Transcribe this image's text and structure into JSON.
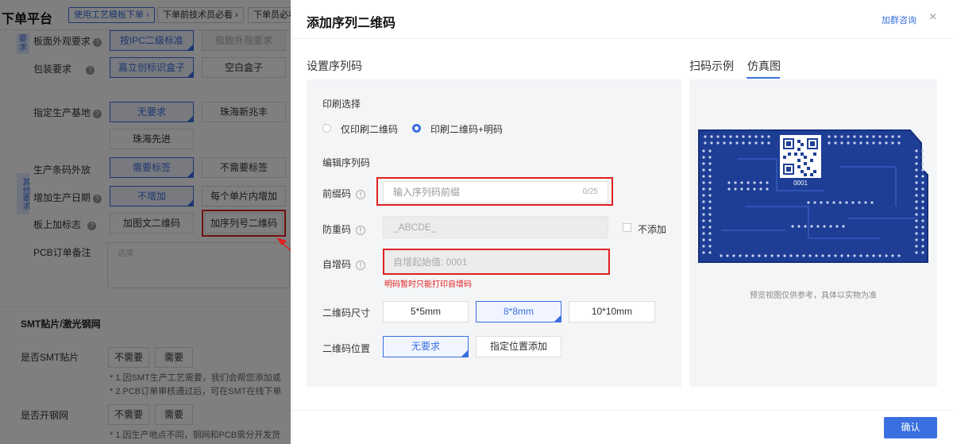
{
  "background": {
    "brand": "下单平台",
    "tabs": [
      "使用工艺模板下单 ›",
      "下单前技术员必看 ›",
      "下单员必看"
    ],
    "side_tags": {
      "req": "要求",
      "other": "其他要求"
    },
    "rows": {
      "board_appearance": {
        "label": "板面外观要求",
        "opt1": "按IPC二级标准",
        "opt2": "极致外观要求"
      },
      "packaging": {
        "label": "包装要求",
        "opt1": "嘉立创标识盒子",
        "opt2": "空白盒子"
      },
      "production_base": {
        "label": "指定生产基地",
        "opt1": "无要求",
        "opt2": "珠海新兆丰",
        "opt3": "珠海先进"
      },
      "barcode": {
        "label": "生产条码外放",
        "opt1": "需要标签",
        "opt2": "不需要标签"
      },
      "date": {
        "label": "增加生产日期",
        "opt1": "不增加",
        "opt2": "每个单片内增加"
      },
      "mark": {
        "label": "板上加标志",
        "opt1": "加图文二维码",
        "opt2": "加序列号二维码"
      },
      "remark": {
        "label": "PCB订单备注",
        "placeholder": "选填"
      }
    },
    "smt_section": "SMT贴片/激光钢网",
    "smt_row": {
      "label": "是否SMT贴片",
      "opt1": "不需要",
      "opt2": "需要"
    },
    "smt_notes": [
      "* 1.因SMT生产工艺需要，我们会帮您添加或",
      "* 2.PCB订单审核通过后，可在SMT在线下单"
    ],
    "stencil_row": {
      "label": "是否开钢网",
      "opt1": "不需要",
      "opt2": "需要"
    },
    "stencil_notes": [
      "* 1.因生产地点不同，钢网和PCB需分开发货"
    ]
  },
  "dialog": {
    "title": "添加序列二维码",
    "join_link": "加群咨询",
    "close_glyph": "×",
    "section_title": "设置序列码",
    "right_tabs": [
      "扫码示例",
      "仿真图"
    ],
    "print_choice_label": "印刷选择",
    "print_options": [
      "仅印刷二维码",
      "印刷二维码+明码"
    ],
    "edit_label": "编辑序列码",
    "prefix": {
      "label": "前缀码",
      "placeholder": "输入序列码前缀",
      "counter": "0/25"
    },
    "dedupe": {
      "label": "防重码",
      "value": "_ABCDE_",
      "checkbox_label": "不添加"
    },
    "increment": {
      "label": "自增码",
      "placeholder": "自增起始值:   0001",
      "error": "明码暂时只能打印自增码"
    },
    "qr_size": {
      "label": "二维码尺寸",
      "options": [
        "5*5mm",
        "8*8mm",
        "10*10mm"
      ]
    },
    "qr_position": {
      "label": "二维码位置",
      "options": [
        "无要求",
        "指定位置添加"
      ]
    },
    "preview_caption": "预览视图仅供参考，具体以实物为准",
    "pcb_serial": "0001",
    "confirm": "确认",
    "info_glyph": "!"
  },
  "colors": {
    "accent": "#3a6fe0",
    "highlight": "#e02020",
    "pcb": "#1e3e96"
  }
}
